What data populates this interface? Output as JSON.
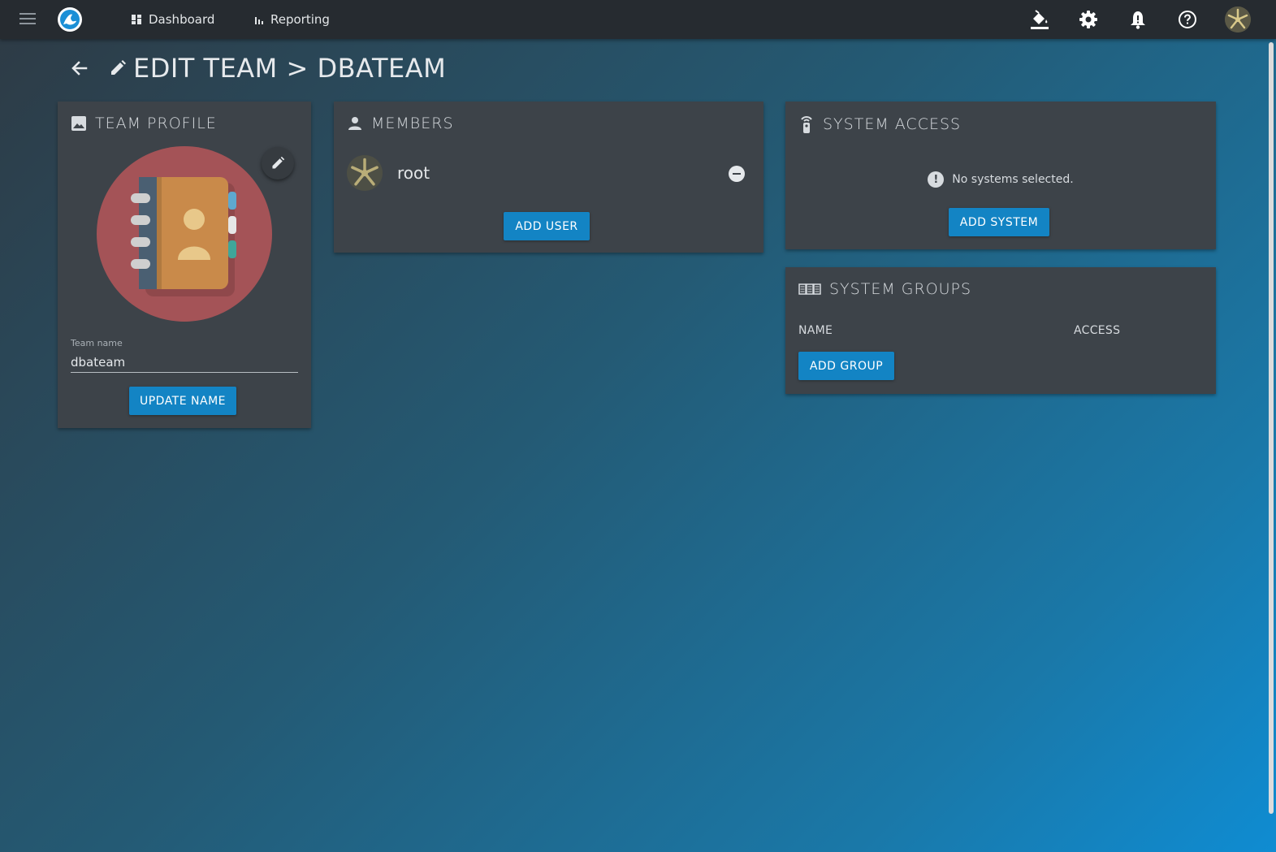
{
  "nav": {
    "dashboard": "Dashboard",
    "reporting": "Reporting"
  },
  "page": {
    "title": "EDIT TEAM > DBATEAM"
  },
  "team_profile": {
    "title": "TEAM PROFILE",
    "field_label": "Team name",
    "field_value": "dbateam",
    "button": "UPDATE NAME"
  },
  "members": {
    "title": "MEMBERS",
    "list": [
      {
        "name": "root"
      }
    ],
    "button": "ADD USER"
  },
  "system_access": {
    "title": "SYSTEM ACCESS",
    "empty_message": "No systems selected.",
    "button": "ADD SYSTEM"
  },
  "system_groups": {
    "title": "SYSTEM GROUPS",
    "columns": [
      "NAME",
      "ACCESS"
    ],
    "button": "ADD GROUP"
  },
  "colors": {
    "topbar": "#262b30",
    "card": "#3d4349",
    "accent": "#1384c4",
    "avatar_bg": "#a45357"
  }
}
